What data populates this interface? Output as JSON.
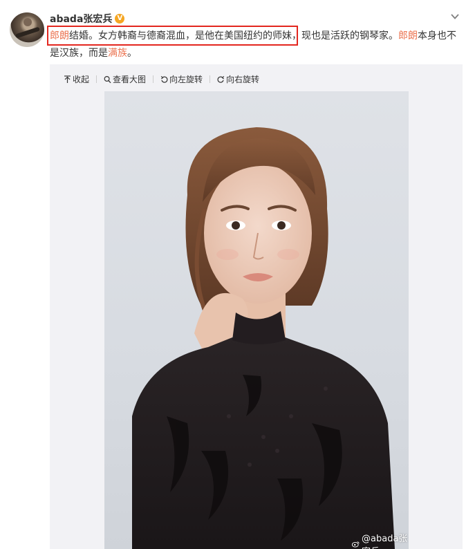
{
  "post": {
    "username": "abada张宏兵",
    "verified_badge": "V",
    "text": {
      "seg1": "郎朗",
      "seg2": "结婚。女方韩裔与德裔混血，是他在美国纽约的师妹，现也是活跃的钢琴家。",
      "seg3": "郎朗",
      "seg4": "本身也不是汉族，而是",
      "seg5": "满族",
      "seg6": "。"
    }
  },
  "toolbar": {
    "collapse_label": "收起",
    "view_large_label": "查看大图",
    "rotate_left_label": "向左旋转",
    "rotate_right_label": "向右旋转"
  },
  "watermark": {
    "text": "@abada张宏兵"
  },
  "colors": {
    "highlight": "#eb7350",
    "annotation_box": "#e3261e",
    "verified": "#f5a623",
    "media_bg": "#f2f2f5"
  },
  "icons": [
    "avatar",
    "verified-icon",
    "chevron-down-icon",
    "collapse-arrow-icon",
    "magnifier-icon",
    "rotate-left-icon",
    "rotate-right-icon",
    "weibo-logo-icon"
  ]
}
